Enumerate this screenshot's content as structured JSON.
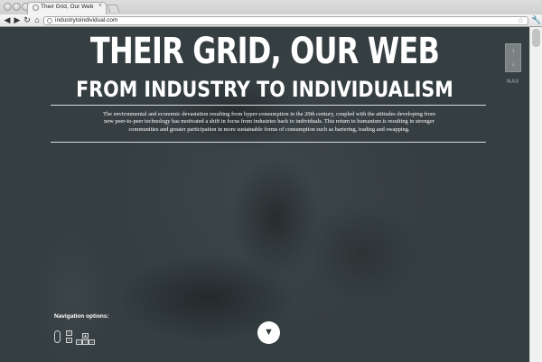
{
  "browser": {
    "tab_title": "Their Grid, Our Web",
    "tab_close": "×",
    "url": "industrytoindividual.com",
    "back_glyph": "◀",
    "forward_glyph": "▶",
    "reload_glyph": "↻",
    "home_glyph": "⌂",
    "star_glyph": "☆",
    "wrench_glyph": "🔧"
  },
  "hero": {
    "title": "THEIR GRID, OUR WEB",
    "subtitle": "FROM INDUSTRY TO INDIVIDUALISM",
    "intro": "The environmental and economic devastation resulting from hyper-consumption in the 20th century, coupled with the attitudes developing from new peer-to-peer technology has motivated a shift in focus from industries back to individuals. This return to humanism is resulting in stronger communities and greater participation in more sustainable forms of consumption such as bartering, trading and swapping."
  },
  "side_nav": {
    "up_glyph": "↑",
    "down_glyph": "↓",
    "label": "NAV"
  },
  "navigation_options": {
    "label": "Navigation options:",
    "key_up": "↑",
    "key_down": "↓",
    "key_left": "←",
    "key_right": "→",
    "key_top": "▲"
  },
  "scroll_down_button": {
    "glyph": "▼"
  },
  "colors": {
    "background": "#3a4447",
    "text": "#ffffff",
    "nav_widget": "#7a8183"
  },
  "icons": [
    "back-icon",
    "forward-icon",
    "reload-icon",
    "home-icon",
    "star-icon",
    "wrench-icon",
    "mouse-icon",
    "arrow-down-icon"
  ]
}
